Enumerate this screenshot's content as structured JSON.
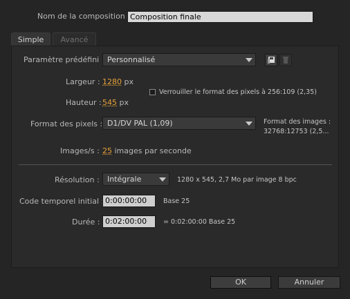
{
  "name_label": "Nom de la composition :",
  "name_value": "Composition finale",
  "tabs": [
    {
      "label": "Simple"
    },
    {
      "label": "Avancé"
    }
  ],
  "preset": {
    "label": "Paramètre prédéfini :",
    "value": "Personnalisé",
    "save_icon": "save-preset-icon",
    "delete_icon": "trash-icon"
  },
  "width": {
    "label": "Largeur :",
    "value": "1280",
    "unit": "px"
  },
  "height": {
    "label": "Hauteur :",
    "value": "545",
    "unit": "px"
  },
  "lock_aspect": {
    "label": "Verrouiller le format des pixels à 256:109 (2,35)",
    "checked": false
  },
  "pixel_aspect": {
    "label": "Format des pixels :",
    "value": "D1/DV PAL (1,09)",
    "frame_aspect_label": "Format des images :",
    "frame_aspect_value": "32768:12753 (2,5..."
  },
  "fps": {
    "label": "Images/s :",
    "value": "25",
    "unit": "images par seconde"
  },
  "resolution": {
    "label": "Résolution :",
    "value": "Intégrale",
    "info": "1280 x 545, 2,7 Mo par image 8 bpc"
  },
  "start_timecode": {
    "label": "Code temporel initial :",
    "value": "0:00:00:00",
    "base": "Base 25"
  },
  "duration": {
    "label": "Durée :",
    "value": "0:02:00:00",
    "info": "= 0:02:00:00  Base 25"
  },
  "buttons": {
    "ok": "OK",
    "cancel": "Annuler"
  },
  "colors": {
    "background": "#252525",
    "accent_scrub": "#e8a23a",
    "text": "#b9b9b9"
  }
}
